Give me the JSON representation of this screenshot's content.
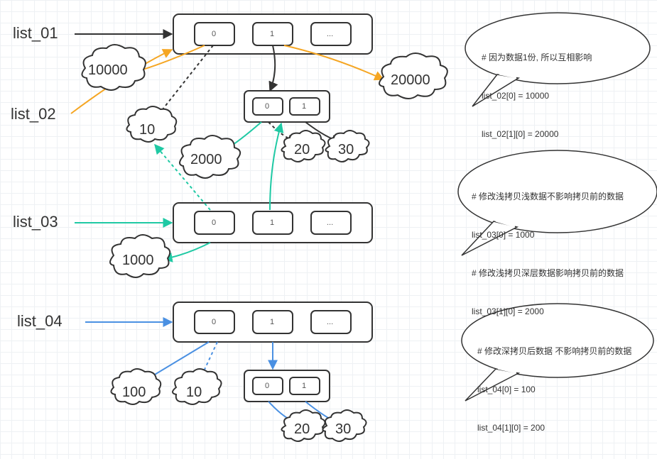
{
  "labels": {
    "list_01": "list_01",
    "list_02": "list_02",
    "list_03": "list_03",
    "list_04": "list_04"
  },
  "cells": {
    "zero": "0",
    "one": "1",
    "dots": "..."
  },
  "clouds": {
    "c10000": "10000",
    "c10a": "10",
    "c2000": "2000",
    "c20a": "20",
    "c30a": "30",
    "c20000": "20000",
    "c1000": "1000",
    "c100": "100",
    "c10b": "10",
    "c20b": "20",
    "c30b": "30"
  },
  "notes": {
    "n1_l1": "# 因为数据1份, 所以互相影响",
    "n1_l2": "list_02[0] = 10000",
    "n1_l3": "list_02[1][0] = 20000",
    "n2_l1": "# 修改浅拷贝浅数据不影响拷贝前的数据",
    "n2_l2": "list_03[0] = 1000",
    "n2_l3": "# 修改浅拷贝深层数据影响拷贝前的数据",
    "n2_l4": "list_03[1][0] = 2000",
    "n3_l1": "# 修改深拷贝后数据 不影响拷贝前的数据",
    "n3_l2": "list_04[0] = 100",
    "n3_l3": "list_04[1][0] = 200"
  },
  "colors": {
    "black": "#333333",
    "orange": "#f5a623",
    "teal": "#1fc9a4",
    "blue": "#4a90e2"
  }
}
